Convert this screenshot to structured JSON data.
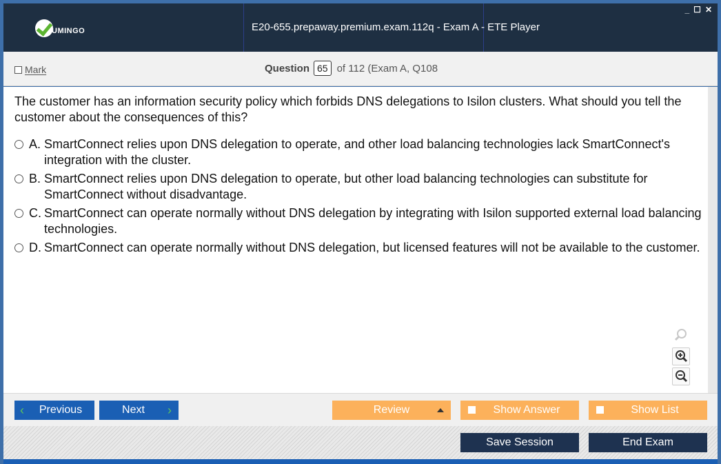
{
  "window": {
    "title": "E20-655.prepaway.premium.exam.112q - Exam A - ETE Player",
    "logo_text": "UMINGO",
    "controls": [
      "_",
      "☐",
      "✕"
    ]
  },
  "question_header": {
    "mark_label": "Mark",
    "question_label": "Question",
    "question_number": "65",
    "of_text": "of 112 (Exam A, Q108"
  },
  "question": {
    "text": "The customer has an information security policy which forbids DNS delegations to Isilon clusters. What should you tell the customer about the consequences of this?",
    "options": [
      {
        "letter": "A.",
        "text": "SmartConnect relies upon DNS delegation to operate, and other load balancing technologies lack SmartConnect's integration with the cluster."
      },
      {
        "letter": "B.",
        "text": "SmartConnect relies upon DNS delegation to operate, but other load balancing technologies can substitute for SmartConnect without disadvantage."
      },
      {
        "letter": "C.",
        "text": "SmartConnect can operate normally without DNS delegation by integrating with Isilon supported external load balancing technologies."
      },
      {
        "letter": "D.",
        "text": "SmartConnect can operate normally without DNS delegation, but licensed features will not be available to the customer."
      }
    ]
  },
  "zoom": {
    "icons": [
      "magnifier-icon",
      "zoom-in-icon",
      "zoom-out-icon"
    ]
  },
  "nav": {
    "previous_label": "Previous",
    "next_label": "Next",
    "review_label": "Review",
    "show_answer_label": "Show Answer",
    "show_list_label": "Show List"
  },
  "footer": {
    "save_session_label": "Save Session",
    "end_exam_label": "End Exam"
  },
  "colors": {
    "title_bar": "#1e2f42",
    "nav_blue": "#1a5fb4",
    "orange": "#fcb15b",
    "dark_button": "#1e3250"
  }
}
